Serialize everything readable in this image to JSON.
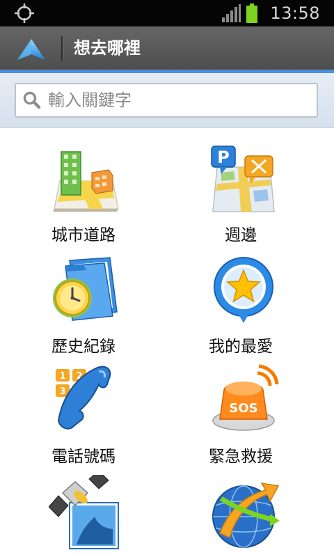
{
  "status_bar": {
    "time": "13:58",
    "left_icon": "gps-crosshair-icon",
    "signal_icon": "signal-icon",
    "battery_icon": "battery-icon",
    "battery_color": "#7ed321"
  },
  "header": {
    "logo_icon": "navigation-arrow-icon",
    "title": "想去哪裡",
    "accent_color": "#4a90d9"
  },
  "search": {
    "placeholder": "輸入關鍵字",
    "icon": "search-icon"
  },
  "menu": [
    {
      "label": "城市道路",
      "icon": "city-road-icon"
    },
    {
      "label": "週邊",
      "icon": "nearby-poi-icon"
    },
    {
      "label": "歷史紀錄",
      "icon": "history-folder-icon"
    },
    {
      "label": "我的最愛",
      "icon": "favorite-star-icon"
    },
    {
      "label": "電話號碼",
      "icon": "phone-keypad-icon"
    },
    {
      "label": "緊急救援",
      "icon": "sos-siren-icon"
    },
    {
      "label": "",
      "icon": "satellite-icon"
    },
    {
      "label": "",
      "icon": "globe-arrow-icon"
    }
  ]
}
